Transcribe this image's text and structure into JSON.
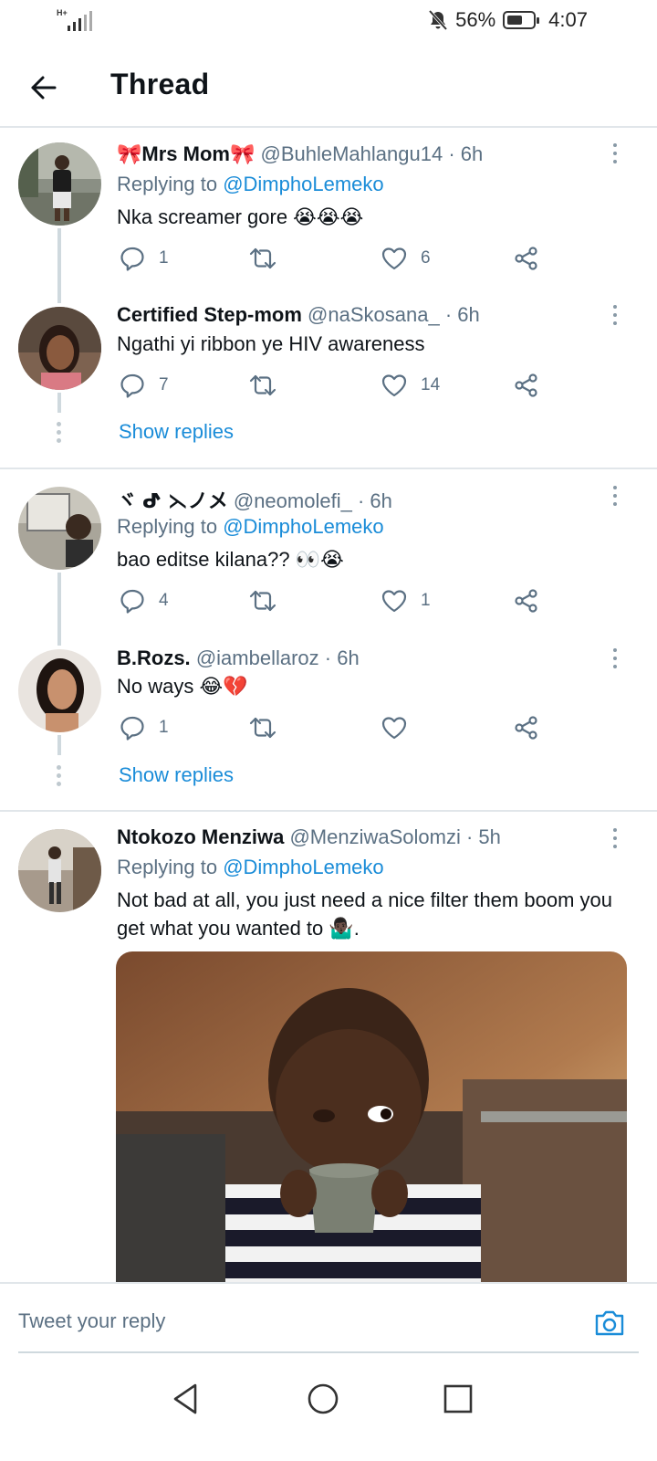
{
  "status_bar": {
    "network": "H+",
    "battery_percent": "56%",
    "time": "4:07",
    "icons": [
      "signal-icon",
      "mute-icon",
      "battery-saver-icon"
    ]
  },
  "header": {
    "title": "Thread",
    "back_icon": "back-arrow-icon"
  },
  "tweets": [
    {
      "name": "🎀Mrs Mom🎀",
      "handle": "@BuhleMahlangu14",
      "time": "· 6h",
      "replying_prefix": "Replying to",
      "replying_to": "@DimphoLemeko",
      "text": "Nka screamer gore 😭😭😭",
      "replies": "1",
      "retweets": "",
      "likes": "6"
    },
    {
      "name": "Certified Step-mom",
      "handle": "@naSkosana_",
      "time": "· 6h",
      "text": "Ngathi yi ribbon ye HIV awareness",
      "replies": "7",
      "retweets": "",
      "likes": "14",
      "show_replies": "Show replies"
    },
    {
      "name": "ヾ ᕷ ⋋ノメ",
      "handle": "@neomolefi_",
      "time": "· 6h",
      "replying_prefix": "Replying to",
      "replying_to": "@DimphoLemeko",
      "text": "bao editse kilana?? 👀😭",
      "replies": "4",
      "retweets": "",
      "likes": "1"
    },
    {
      "name": "B.Rozs.",
      "handle": "@iambellaroz",
      "time": "· 6h",
      "text": "No ways 😂💔",
      "replies": "1",
      "retweets": "",
      "likes": "",
      "show_replies": "Show replies"
    },
    {
      "name": "Ntokozo Menziwa",
      "handle": "@MenziwaSolomzi",
      "time": "· 5h",
      "replying_prefix": "Replying to",
      "replying_to": "@DimphoLemeko",
      "text": "Not bad at all, you just need a nice filter them boom you get what you wanted to 🤷🏿‍♂️.",
      "has_image": true
    }
  ],
  "reply_bar": {
    "placeholder": "Tweet your reply",
    "camera_icon": "camera-icon"
  },
  "nav_bar": {
    "icons": [
      "back-triangle-icon",
      "home-circle-icon",
      "recents-square-icon"
    ]
  },
  "colors": {
    "link": "#1a8cd8",
    "secondary_text": "#5b7083",
    "divider": "#e1e6ea"
  }
}
